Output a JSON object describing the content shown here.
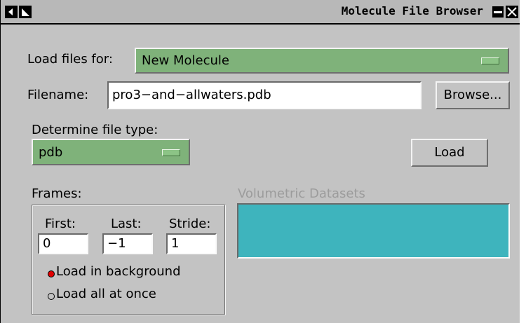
{
  "window": {
    "title": "Molecule File Browser"
  },
  "load_for": {
    "label": "Load files for:",
    "value": "New Molecule"
  },
  "filename": {
    "label": "Filename:",
    "value": "pro3−and−allwaters.pdb",
    "browse_label": "Browse..."
  },
  "filetype": {
    "label": "Determine file type:",
    "value": "pdb"
  },
  "load_button": "Load",
  "frames": {
    "label": "Frames:",
    "first_label": "First:",
    "first_value": "0",
    "last_label": "Last:",
    "last_value": "−1",
    "stride_label": "Stride:",
    "stride_value": "1",
    "options": [
      {
        "label": "Load in background",
        "selected": true
      },
      {
        "label": "Load all at once",
        "selected": false
      }
    ]
  },
  "volumetric": {
    "label": "Volumetric Datasets"
  },
  "colors": {
    "window_bg": "#c3c3c3",
    "option_menu_green": "#7fb27a",
    "listbox_teal": "#3eb4bd",
    "radio_selected": "#e00000",
    "disabled_text": "#9c9c9c"
  }
}
